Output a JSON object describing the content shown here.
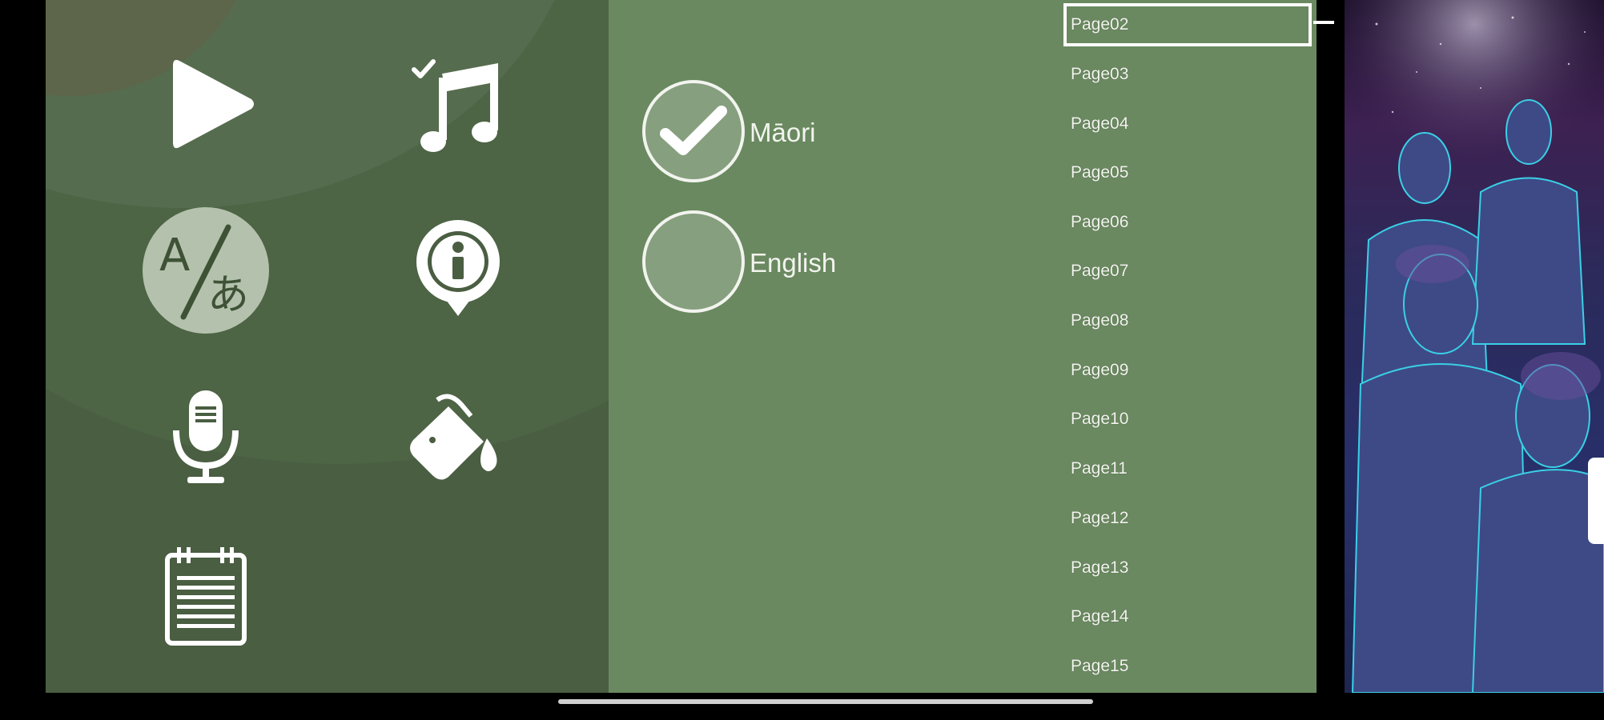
{
  "menu": {
    "icons": {
      "play": "play-icon",
      "music": "music-note-check-icon",
      "translate": "translate-icon",
      "info": "info-icon",
      "microphone": "microphone-icon",
      "paint": "paint-bucket-icon",
      "notepad": "notepad-icon"
    }
  },
  "language": {
    "options": [
      {
        "label": "Māori",
        "checked": true
      },
      {
        "label": "English",
        "checked": false
      }
    ]
  },
  "pages": {
    "items": [
      "Page02",
      "Page03",
      "Page04",
      "Page05",
      "Page06",
      "Page07",
      "Page08",
      "Page09",
      "Page10",
      "Page11",
      "Page12",
      "Page13",
      "Page14",
      "Page15"
    ],
    "selected": "Page02"
  },
  "colors": {
    "menu_panel": "#4a5e42",
    "language_panel": "#6a8960",
    "foreground": "#f2f4ee"
  }
}
